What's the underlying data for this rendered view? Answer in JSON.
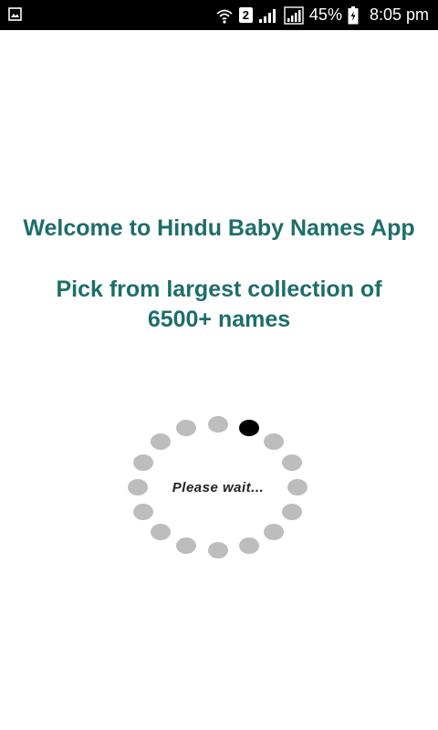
{
  "status_bar": {
    "icons": [
      "gallery-icon",
      "wifi-icon",
      "sim-icon",
      "signal-icon",
      "signal-icon",
      "battery-icon"
    ],
    "sim_label": "2",
    "battery": "45%",
    "time": "8:05 pm"
  },
  "main": {
    "welcome": "Welcome to Hindu Baby Names App",
    "pick": "Pick from largest collection of 6500+ names"
  },
  "loader": {
    "label": "Please wait..."
  }
}
